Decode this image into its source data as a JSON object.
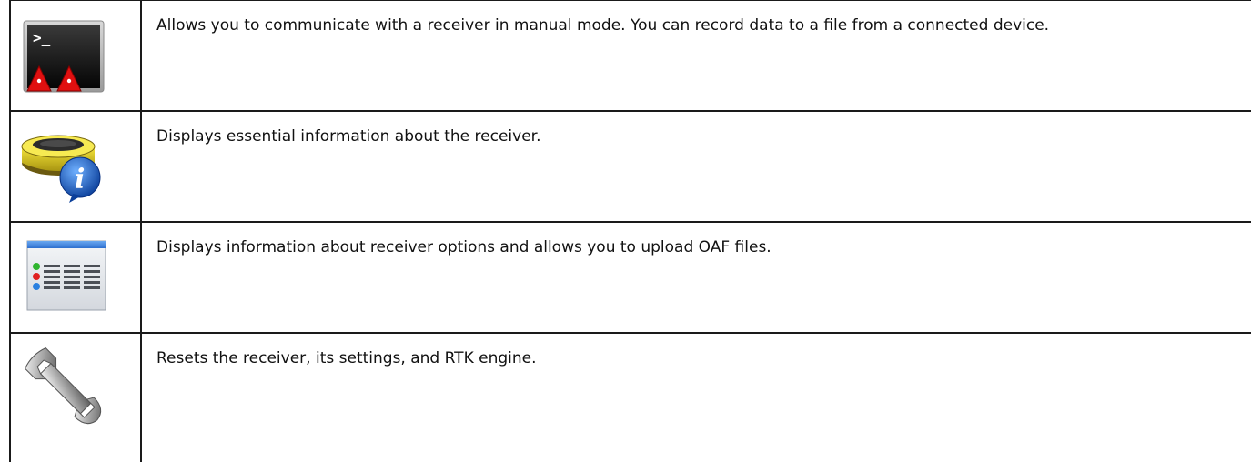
{
  "rows": [
    {
      "icon": "terminal-icon",
      "description": "Allows you to communicate with a receiver in manual mode. You can record data to a file from a connected device."
    },
    {
      "icon": "receiver-info-icon",
      "description": "Displays essential information about the receiver."
    },
    {
      "icon": "options-list-icon",
      "description": "Displays information about receiver options and allows you to upload OAF files."
    },
    {
      "icon": "wrench-icon",
      "description": "Resets the receiver, its settings, and RTK engine."
    }
  ],
  "colors": {
    "border": "#1a1a1a",
    "warning_red": "#e01010",
    "info_blue": "#1a5fc8",
    "receiver_yellow": "#e8d21a"
  }
}
